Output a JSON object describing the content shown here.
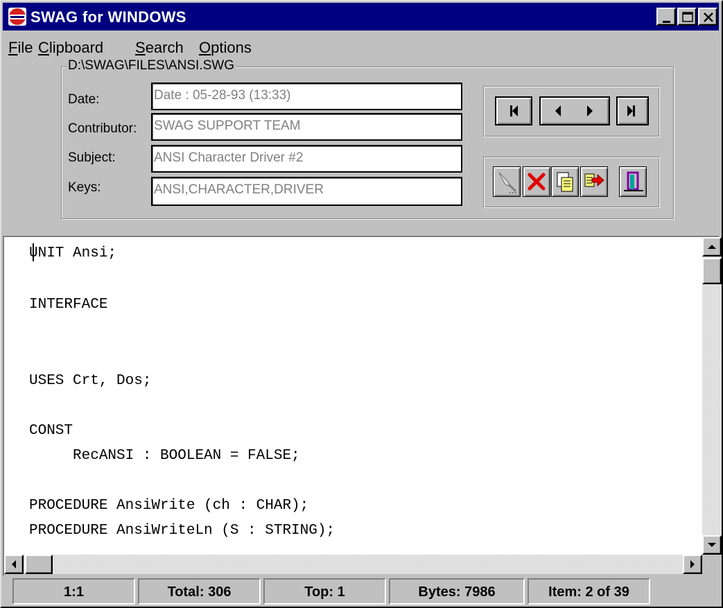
{
  "window": {
    "title": "SWAG for WINDOWS"
  },
  "menu": {
    "items": [
      "File",
      "Clipboard",
      "Search",
      "Options"
    ]
  },
  "file_info": {
    "path": "D:\\SWAG\\FILES\\ANSI.SWG",
    "date_label": "Date:",
    "date_value": "Date : 05-28-93 (13:33)",
    "contributor_label": "Contributor:",
    "contributor_value": "SWAG SUPPORT TEAM",
    "subject_label": "Subject:",
    "subject_value": "ANSI Character Driver #2",
    "keys_label": "Keys:",
    "keys_value": "ANSI,CHARACTER,DRIVER"
  },
  "navigation": {
    "buttons": [
      "first-record-icon",
      "previous-record-icon",
      "next-record-icon",
      "last-record-icon"
    ]
  },
  "toolbar": {
    "buttons": [
      "flashlight-icon",
      "delete-x-icon",
      "copy-document-icon",
      "export-arrow-icon",
      "exit-door-icon"
    ]
  },
  "editor": {
    "lines": [
      "UNIT Ansi;",
      "",
      "INTERFACE",
      "",
      "",
      "",
      "USES Crt, Dos;",
      "",
      "CONST",
      "     RecANSI : BOOLEAN = FALSE;",
      "",
      "PROCEDURE AnsiWrite (ch : CHAR);",
      "PROCEDURE AnsiWriteLn (S : STRING);"
    ]
  },
  "statusbar": {
    "position": "1:1",
    "total": "Total: 306",
    "top": "Top: 1",
    "bytes": "Bytes: 7986",
    "item": "Item: 2 of 39"
  },
  "colors": {
    "titlebar": "#000080",
    "face": "#c0c0c0",
    "field_text": "#808080",
    "delete_icon": "#e00000"
  }
}
